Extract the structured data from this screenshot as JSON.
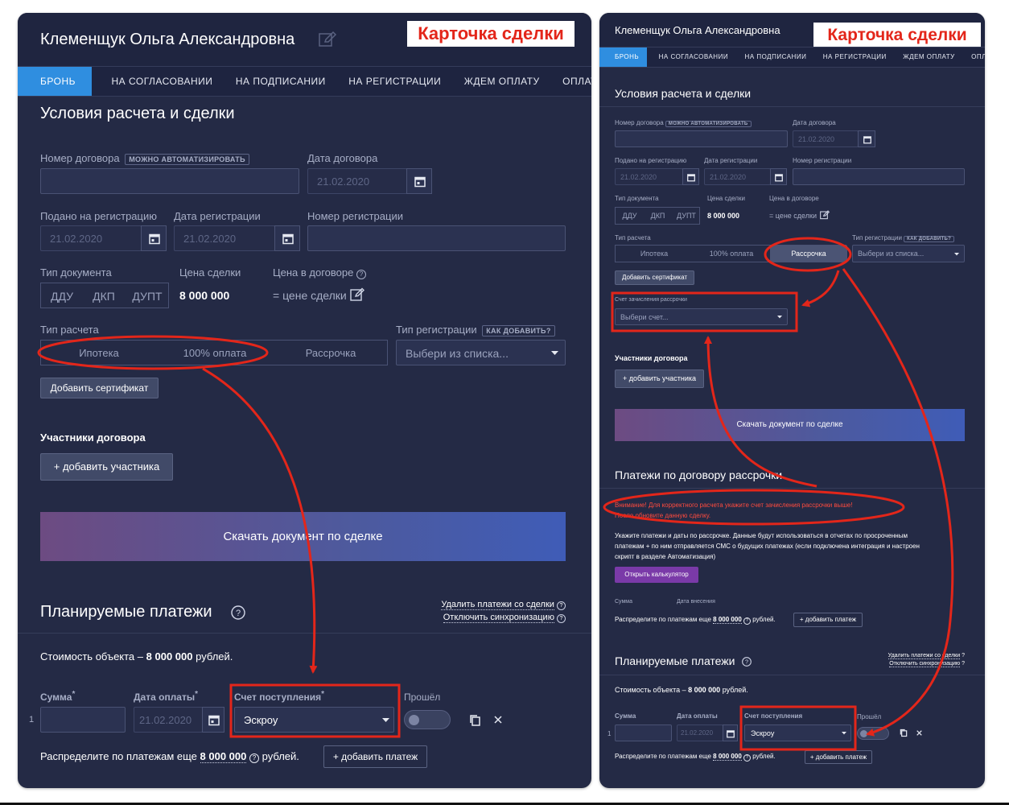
{
  "header": {
    "name": "Клеменщук Ольга Александровна",
    "badge": "Карточка сделки"
  },
  "tabs": [
    "БРОНЬ",
    "НА СОГЛАСОВАНИИ",
    "НА ПОДПИСАНИИ",
    "НА РЕГИСТРАЦИИ",
    "ЖДЕМ ОПЛАТУ",
    "ОПЛАТА ПОЛУЧ"
  ],
  "section_title": "Условия расчета и сделки",
  "contract": {
    "number_label": "Номер договора",
    "automate_badge": "МОЖНО АВТОМАТИЗИРОВАТЬ",
    "date_label": "Дата договора",
    "date_value": "21.02.2020"
  },
  "registration": {
    "submitted_label": "Подано на регистрацию",
    "submitted_value": "21.02.2020",
    "date_label": "Дата регистрации",
    "date_value": "21.02.2020",
    "number_label": "Номер регистрации"
  },
  "document": {
    "type_label": "Тип документа",
    "types": [
      "ДДУ",
      "ДКП",
      "ДУПТ"
    ],
    "price_label": "Цена сделки",
    "price_value": "8 000 000",
    "contract_price_label": "Цена в договоре",
    "contract_price_value": "= цене сделки"
  },
  "payment": {
    "type_label": "Тип расчета",
    "types": [
      "Ипотека",
      "100% оплата",
      "Рассрочка"
    ],
    "reg_type_label": "Тип регистрации",
    "how_badge": "КАК ДОБАВИТЬ?",
    "reg_type_placeholder": "Выбери из списка...",
    "add_certificate": "Добавить сертификат",
    "installment_account_label": "Счет зачисления рассрочки",
    "installment_account_placeholder": "Выбери счет..."
  },
  "participants": {
    "title": "Участники договора",
    "add": "+ добавить участника"
  },
  "download": "Скачать документ по сделке",
  "installments": {
    "title": "Платежи по договору рассрочки",
    "warning_1": "Внимание! Для корректного расчета укажите счет зачисления рассрочки выше!",
    "warning_2": "После обновите данную сделку.",
    "info_1": "Укажите платежи и даты по рассрочке. Данные будут использоваться в отчетах по просроченным",
    "info_2": "платежам + по ним отправляется СМС о будущих платежах (если подключена интеграция и настроен",
    "info_3": "скрипт в разделе Автоматизация)",
    "calculator": "Открыть калькулятор",
    "sum_col": "Сумма",
    "date_col": "Дата внесения"
  },
  "planned": {
    "title": "Планируемые платежи",
    "delete_link": "Удалить платежи со сделки",
    "sync_link": "Отключить синхронизацию",
    "cost_prefix": "Стоимость объекта –",
    "cost_value": "8 000 000",
    "cost_suffix": "рублей.",
    "sum_col": "Сумма",
    "date_col": "Дата оплаты",
    "account_col": "Счет поступления",
    "passed_col": "Прошёл",
    "row_num": "1",
    "row_date": "21.02.2020",
    "row_account": "Эскроу",
    "distribute_prefix": "Распределите по платежам еще",
    "distribute_value": "8 000 000",
    "distribute_suffix": "рублей.",
    "add_payment": "+ добавить платеж"
  },
  "icons": {
    "copy": "copy-icon",
    "close": "close-icon",
    "calendar": "calendar-icon",
    "edit": "pencil-icon",
    "help": "help-circle-icon",
    "dropdown": "caret-down-icon"
  },
  "colors": {
    "panel": "#242a45",
    "accent": "#2f8ee0",
    "annotation": "#e3261a",
    "calculator": "#7a3aa8"
  }
}
